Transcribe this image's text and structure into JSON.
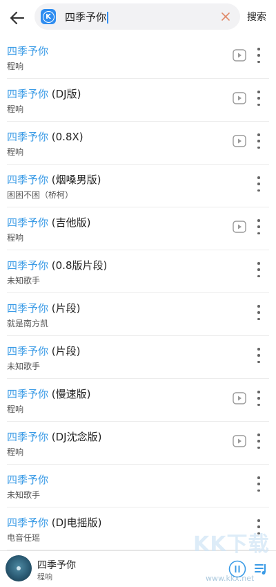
{
  "header": {
    "search_query": "四季予你",
    "search_button": "搜索"
  },
  "songs": [
    {
      "hl": "四季予你",
      "suffix": "",
      "artist": "程响",
      "has_mv": true
    },
    {
      "hl": "四季予你",
      "suffix": " (DJ版)",
      "artist": "程响",
      "has_mv": true
    },
    {
      "hl": "四季予你",
      "suffix": " (0.8X)",
      "artist": "程响",
      "has_mv": true
    },
    {
      "hl": "四季予你",
      "suffix": " (烟嗓男版)",
      "artist": "困困不困（桥柯）",
      "has_mv": false
    },
    {
      "hl": "四季予你",
      "suffix": " (吉他版)",
      "artist": "程响",
      "has_mv": true
    },
    {
      "hl": "四季予你",
      "suffix": " (0.8版片段)",
      "artist": "未知歌手",
      "has_mv": false
    },
    {
      "hl": "四季予你",
      "suffix": " (片段)",
      "artist": "就是南方凯",
      "has_mv": false
    },
    {
      "hl": "四季予你",
      "suffix": " (片段)",
      "artist": "未知歌手",
      "has_mv": false
    },
    {
      "hl": "四季予你",
      "suffix": " (慢速版)",
      "artist": "程响",
      "has_mv": true
    },
    {
      "hl": "四季予你",
      "suffix": " (DJ沈念版)",
      "artist": "程响",
      "has_mv": true
    },
    {
      "hl": "四季予你",
      "suffix": "",
      "artist": "未知歌手",
      "has_mv": false
    },
    {
      "hl": "四季予你",
      "suffix": " (DJ电摇版)",
      "artist": "电音任瑶",
      "has_mv": false
    }
  ],
  "player": {
    "title": "四季予你",
    "artist": "程响"
  },
  "watermark": {
    "text": "KK下载",
    "url": "www.kkx.net"
  },
  "icons": {
    "back": "arrow-left-icon",
    "logo": "kugou-k-icon",
    "clear": "close-icon",
    "mv": "mv-play-icon",
    "more": "more-vertical-icon",
    "pause": "pause-icon",
    "queue": "playlist-icon"
  }
}
